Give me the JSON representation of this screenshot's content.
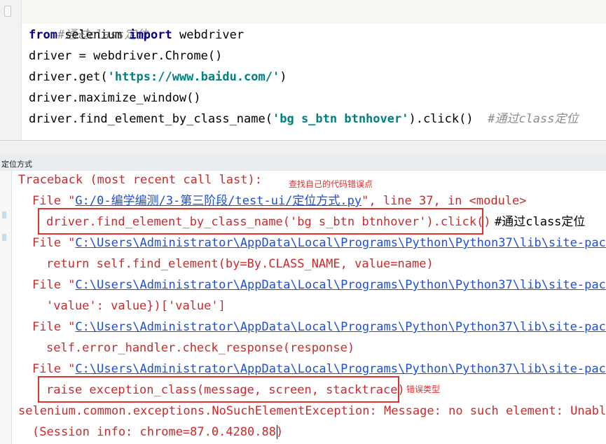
{
  "editor": {
    "lines": {
      "l1": {
        "comment": "#通过class定位"
      },
      "l2": {
        "kw1": "from",
        "mid": " selenium ",
        "kw2": "import",
        "rest": " webdriver"
      },
      "l3": {
        "text": "driver = webdriver.Chrome()"
      },
      "l4": {
        "pre": "driver.get(",
        "str": "'https://www.baidu.com/'",
        "post": ")"
      },
      "l5": {
        "text": "driver.maximize_window()"
      },
      "l6": {
        "pre": "driver.find_element_by_class_name(",
        "str": "'bg s_btn btnhover'",
        "post": ").click()",
        "comment": "#通过class定位"
      }
    }
  },
  "run_panel": {
    "tab_label": "定位方式"
  },
  "console": {
    "traceback": "Traceback (most recent call last):",
    "frame1_pre": "File \"",
    "frame1_path": "G:/0-编学编测/3-第三阶段/test-ui/定位方式.py",
    "frame1_post": "\", line 37, in <module>",
    "frame1_code": "driver.find_element_by_class_name('bg s_btn btnhover').click()",
    "frame1_comment": "#通过class定位",
    "frame2_pre": "File \"",
    "frame2_path": "C:\\Users\\Administrator\\AppData\\Local\\Programs\\Python\\Python37\\lib\\site-packa",
    "frame2_code": "return self.find_element(by=By.CLASS_NAME, value=name)",
    "frame3_pre": "File \"",
    "frame3_path": "C:\\Users\\Administrator\\AppData\\Local\\Programs\\Python\\Python37\\lib\\site-packa",
    "frame3_code": "'value': value})['value']",
    "frame4_pre": "File \"",
    "frame4_path": "C:\\Users\\Administrator\\AppData\\Local\\Programs\\Python\\Python37\\lib\\site-packa",
    "frame4_code": "self.error_handler.check_response(response)",
    "frame5_pre": "File \"",
    "frame5_path": "C:\\Users\\Administrator\\AppData\\Local\\Programs\\Python\\Python37\\lib\\site-packa",
    "frame5_code": "raise exception_class(message, screen, stacktrace)",
    "exception": "selenium.common.exceptions.NoSuchElementException: Message: no such element: Unable",
    "session": "(Session info: chrome=87.0.4280.88)"
  },
  "annotations": {
    "find_own_error": "查找自己的代码错误点",
    "error_type": "错误类型"
  },
  "colors": {
    "error_text": "#cc2a2a",
    "link": "#1e4fd6",
    "keyword": "#000080",
    "string": "#008080",
    "comment": "#8c8c8c",
    "highlight_box": "#e0302c"
  }
}
